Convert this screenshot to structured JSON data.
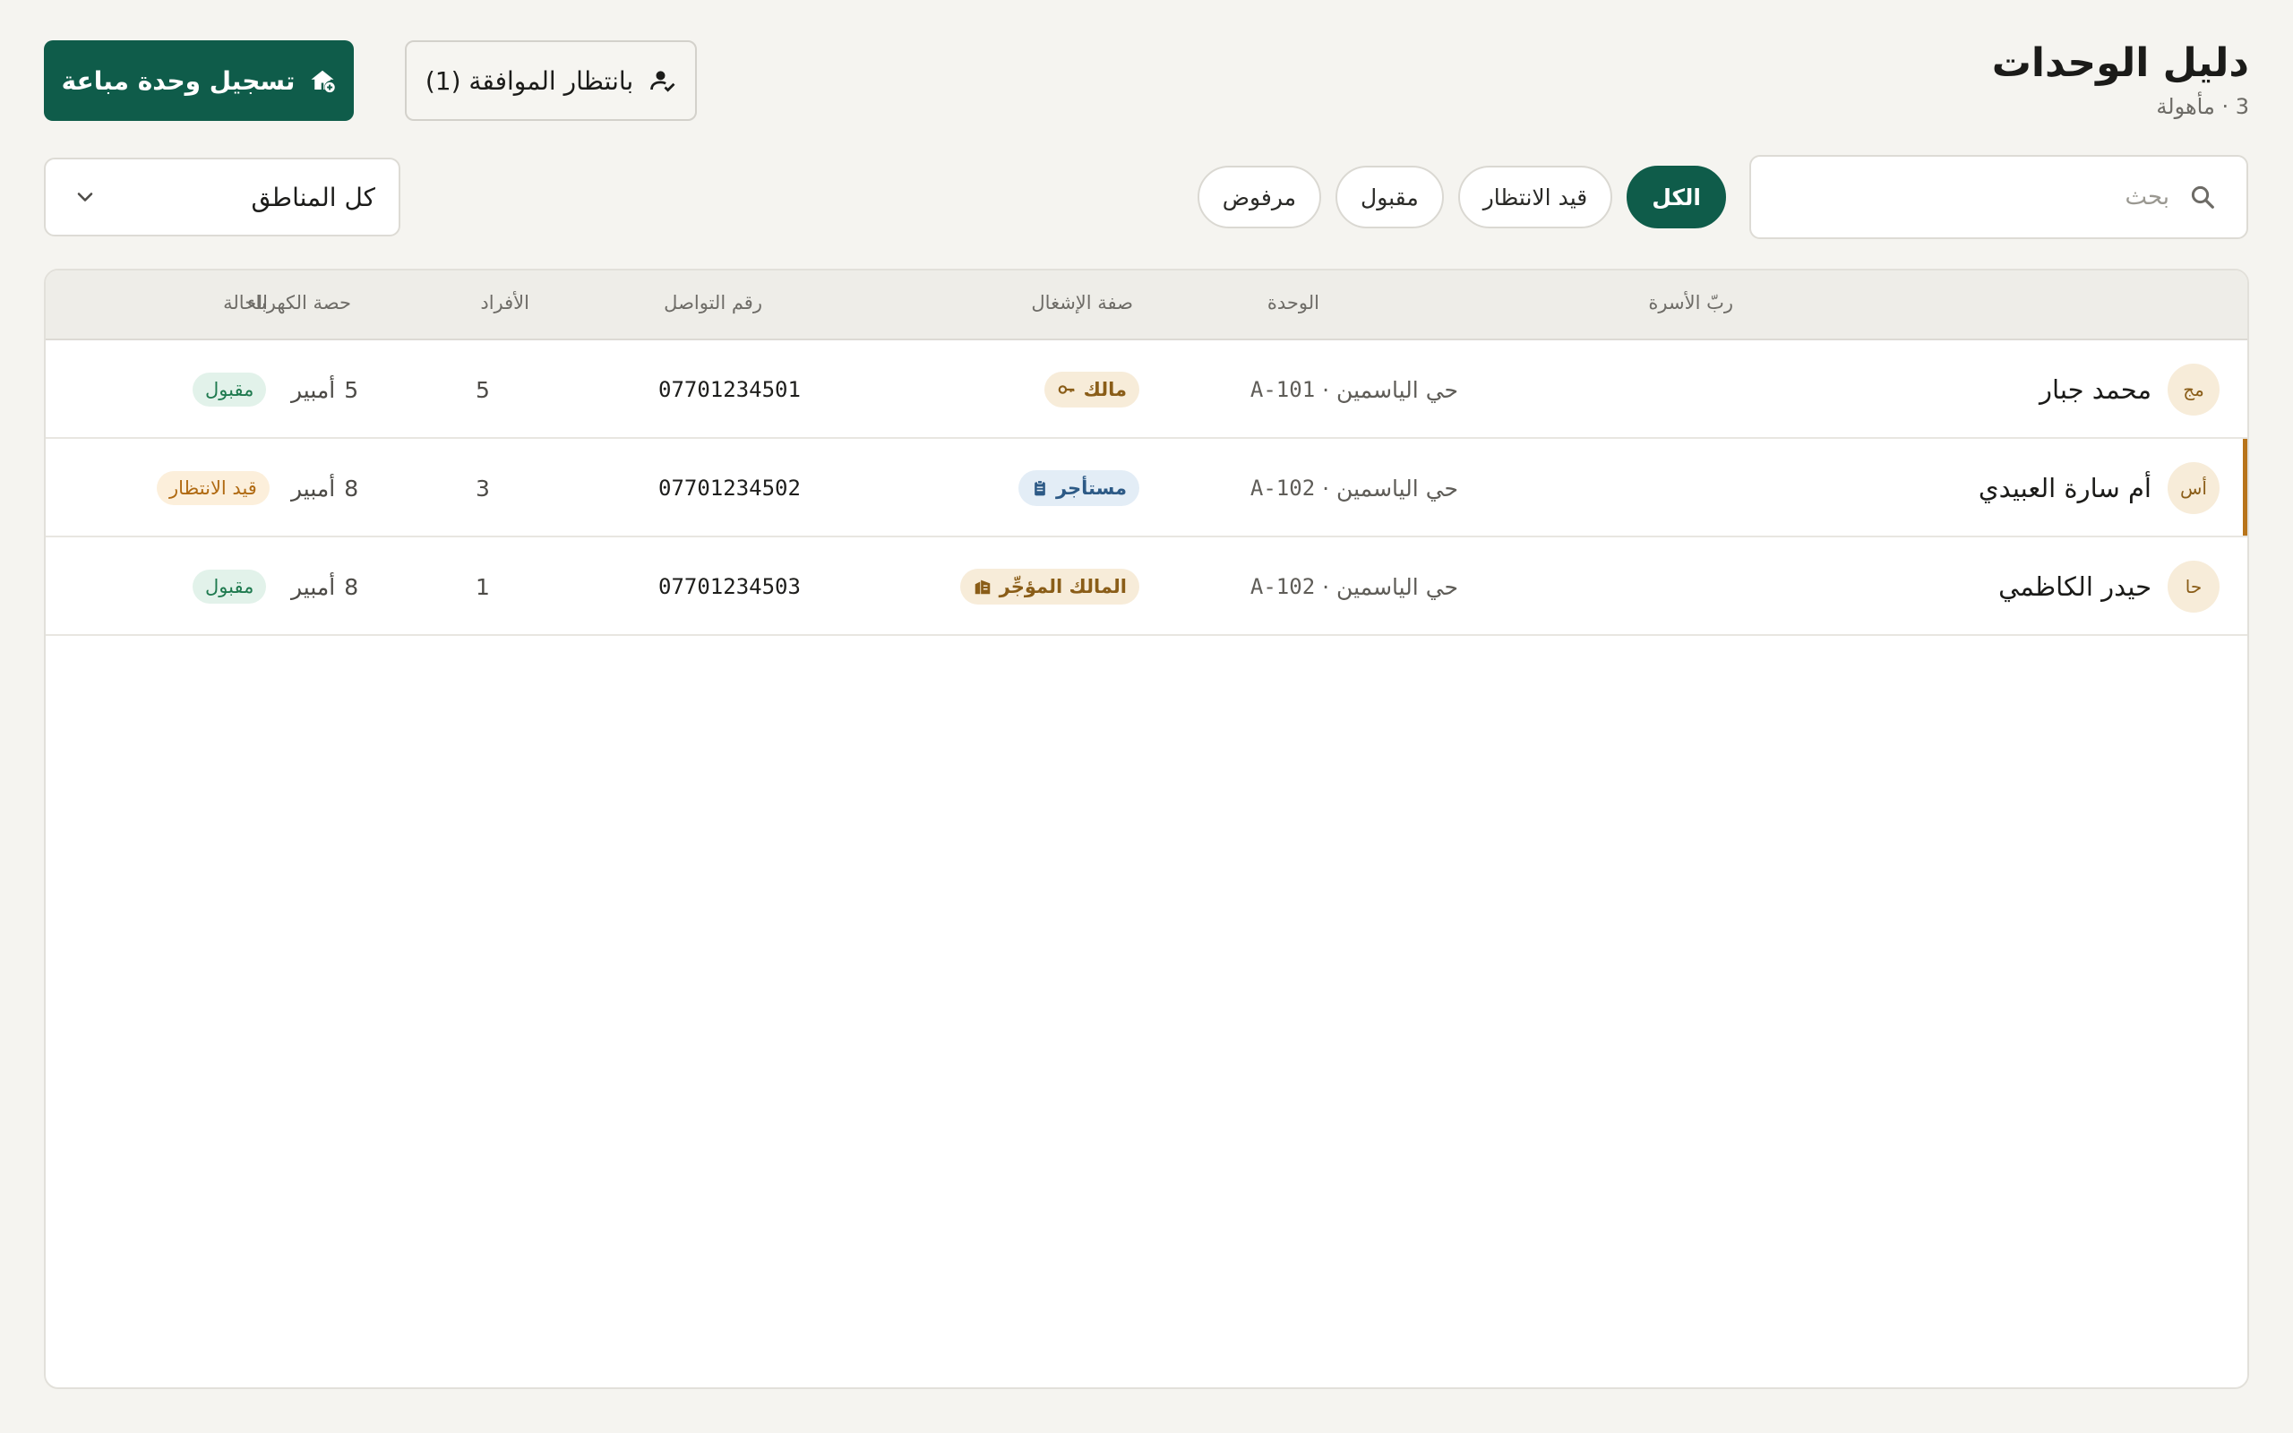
{
  "header": {
    "title": "دليل الوحدات",
    "subtitle": "3 · مأهولة",
    "register_button": "تسجيل وحدة مباعة",
    "pending_button": "بانتظار الموافقة (1)"
  },
  "search": {
    "placeholder": "بحث",
    "value": ""
  },
  "filters": [
    {
      "label": "الكل",
      "active": true
    },
    {
      "label": "قيد الانتظار",
      "active": false
    },
    {
      "label": "مقبول",
      "active": false
    },
    {
      "label": "مرفوض",
      "active": false
    }
  ],
  "region_select": {
    "value": "كل المناطق"
  },
  "table": {
    "columns": {
      "head": "ربّ الأسرة",
      "unit": "الوحدة",
      "occupancy": "صفة الإشغال",
      "phone": "رقم التواصل",
      "members": "الأفراد",
      "power": "حصة الكهرباء",
      "status": "الحالة"
    },
    "rows": [
      {
        "initials": "مج",
        "name": "محمد جبار",
        "unit_area": "حي الياسمين ·",
        "unit_code": "A-101",
        "occupancy": "مالك",
        "occupancy_icon": "key-icon",
        "phone": "07701234501",
        "members": "5",
        "power_value": "5",
        "power_unit": "أمبير",
        "status": "مقبول",
        "status_color": "#1f7a4f"
      },
      {
        "initials": "أس",
        "name": "أم سارة العبيدي",
        "unit_area": "حي الياسمين ·",
        "unit_code": "A-102",
        "occupancy": "مستأجر",
        "occupancy_icon": "clipboard-icon",
        "phone": "07701234502",
        "members": "3",
        "power_value": "8",
        "power_unit": "أمبير",
        "status": "قيد الانتظار",
        "status_color": "#b06a12"
      },
      {
        "initials": "حا",
        "name": "حيدر الكاظمي",
        "unit_area": "حي الياسمين ·",
        "unit_code": "A-102",
        "occupancy": "المالك المؤجِّر",
        "occupancy_icon": "building-icon",
        "phone": "07701234503",
        "members": "1",
        "power_value": "8",
        "power_unit": "أمبير",
        "status": "مقبول",
        "status_color": "#1f7a4f"
      }
    ]
  },
  "colors": {
    "brand": "#0f5c4a",
    "accent": "#b8741a",
    "page_bg": "#f5f4f0"
  }
}
